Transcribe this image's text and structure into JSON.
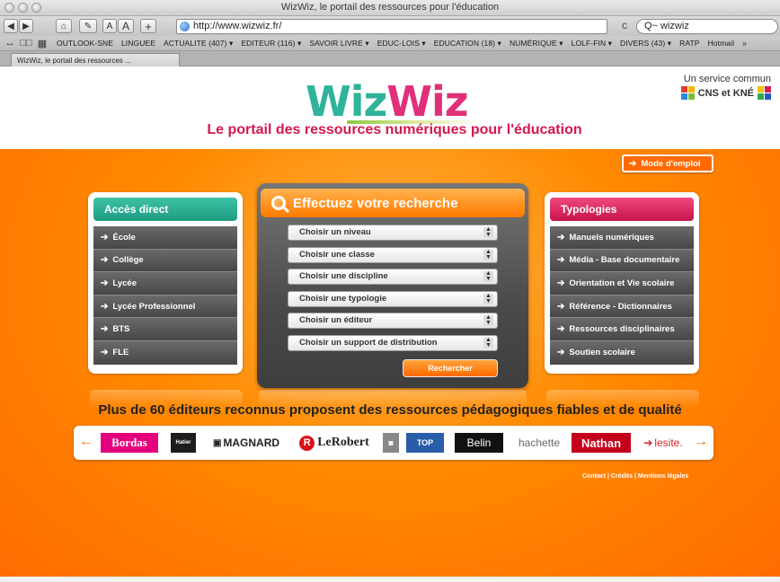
{
  "browser": {
    "window_title": "WizWiz, le portail des ressources pour l'éducation",
    "url": "http://www.wizwiz.fr/",
    "search_value": "wizwiz",
    "toolbar_buttons": [
      "◀",
      "▶",
      "⌂",
      "✎",
      "A",
      "A",
      "+"
    ],
    "reload_icon": "c",
    "search_prefix": "Q~",
    "bookmark_icons": [
      "↔",
      "□□",
      "▦"
    ],
    "bookmarks": [
      "OUTLOOK-SNE",
      "LINGUEE",
      "ACTUALITE (407) ▾",
      "EDITEUR (116) ▾",
      "SAVOIR LIVRE ▾",
      "EDUC-LOIS ▾",
      "EDUCATION (18) ▾",
      "NUMÉRIQUE ▾",
      "LOLF-FIN ▾",
      "DIVERS (43) ▾",
      "RATP",
      "Hotmail",
      "»"
    ],
    "tab_title": "WizWiz, le portail des ressources ..."
  },
  "header": {
    "logo_text": "WizWiz",
    "tagline": "Le portail des ressources numériques pour l'éducation",
    "service_line1": "Un service commun",
    "service_line2": "CNS et KNÉ"
  },
  "mode_emploi": "Mode d'emploi",
  "acces_direct": {
    "title": "Accès direct",
    "items": [
      "École",
      "Collège",
      "Lycée",
      "Lycée Professionnel",
      "BTS",
      "FLE"
    ]
  },
  "search": {
    "title": "Effectuez votre recherche",
    "selects": [
      "Choisir un niveau",
      "Choisir une classe",
      "Choisir une discipline",
      "Choisir une typologie",
      "Choisir un éditeur",
      "Choisir un support de distribution"
    ],
    "button": "Rechercher"
  },
  "typologies": {
    "title": "Typologies",
    "items": [
      "Manuels numériques",
      "Média - Base documentaire",
      "Orientation et Vie scolaire",
      "Référence - Dictionnaires",
      "Ressources disciplinaires",
      "Soutien scolaire"
    ]
  },
  "editors_title": "Plus de 60 éditeurs reconnus proposent des ressources pédagogiques fiables et de qualité",
  "publishers": [
    "Bordas",
    "Hatier",
    "MAGNARD",
    "LeRobert",
    "TOP",
    "Belin",
    "hachette",
    "Nathan",
    "lesite."
  ],
  "footer_links": "Contact | Crédits | Mentions légales",
  "colors": {
    "orange": "#ff8a00",
    "teal": "#2fb39a",
    "pink": "#e0307a",
    "tagline": "#d4184e"
  }
}
